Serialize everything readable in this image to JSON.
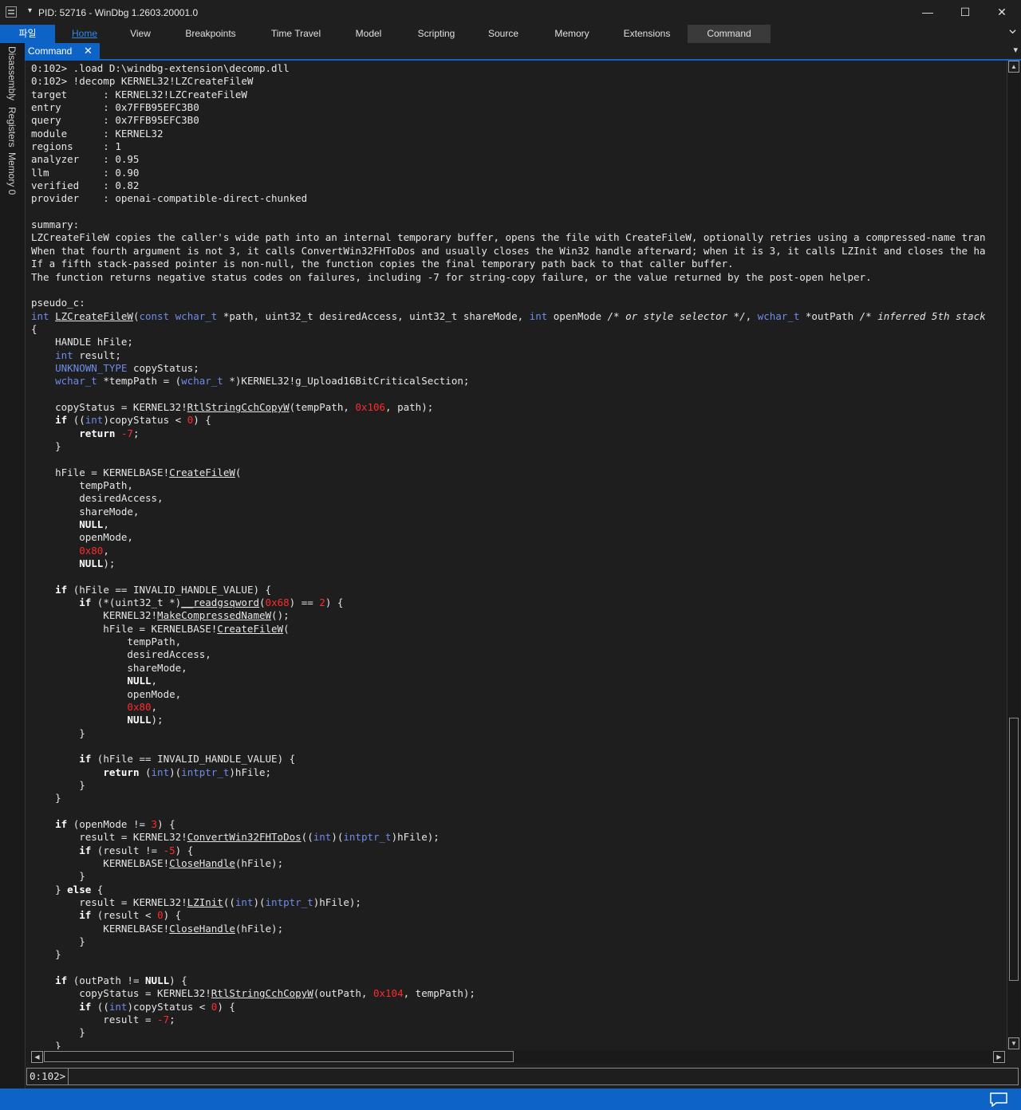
{
  "window": {
    "title": "PID: 52716 - WinDbg 1.2603.20001.0",
    "title_arrow": "▾",
    "buttons": {
      "minimize": "—",
      "maximize": "☐",
      "close": "✕"
    }
  },
  "ribbon": {
    "tabs": [
      {
        "label": "파일"
      },
      {
        "label": "Home"
      },
      {
        "label": "View"
      },
      {
        "label": "Breakpoints"
      },
      {
        "label": "Time Travel"
      },
      {
        "label": "Model"
      },
      {
        "label": "Scripting"
      },
      {
        "label": "Source"
      },
      {
        "label": "Memory"
      },
      {
        "label": "Extensions"
      },
      {
        "label": "Command"
      }
    ],
    "active_tab": "Home",
    "expand_icon": "chevron-down-icon"
  },
  "left_rail": {
    "items": [
      {
        "label": "Disassembly"
      },
      {
        "label": "Registers"
      },
      {
        "label": "Memory 0"
      }
    ]
  },
  "doc_tabs": {
    "tabs": [
      {
        "label": "Command",
        "close": "✕"
      }
    ],
    "menu_glyph": "▾"
  },
  "console": {
    "lines": [
      [
        {
          "t": "0:102> .load D:\\windbg-extension\\decomp.dll"
        }
      ],
      [
        {
          "t": "0:102> !decomp KERNEL32!LZCreateFileW"
        }
      ],
      [
        {
          "t": "target      : KERNEL32!LZCreateFileW"
        }
      ],
      [
        {
          "t": "entry       : 0x7FFB95EFC3B0"
        }
      ],
      [
        {
          "t": "query       : 0x7FFB95EFC3B0"
        }
      ],
      [
        {
          "t": "module      : KERNEL32"
        }
      ],
      [
        {
          "t": "regions     : 1"
        }
      ],
      [
        {
          "t": "analyzer    : 0.95"
        }
      ],
      [
        {
          "t": "llm         : 0.90"
        }
      ],
      [
        {
          "t": "verified    : 0.82"
        }
      ],
      [
        {
          "t": "provider    : openai-compatible-direct-chunked"
        }
      ],
      [
        {
          "t": ""
        }
      ],
      [
        {
          "t": "summary:"
        }
      ],
      [
        {
          "t": "LZCreateFileW copies the caller's wide path into an internal temporary buffer, opens the file with CreateFileW, optionally retries using a compressed-name tran"
        }
      ],
      [
        {
          "t": "When that fourth argument is not 3, it calls ConvertWin32FHToDos and usually closes the Win32 handle afterward; when it is 3, it calls LZInit and closes the ha"
        }
      ],
      [
        {
          "t": "If a fifth stack-passed pointer is non-null, the function copies the final temporary path back to that caller buffer."
        }
      ],
      [
        {
          "t": "The function returns negative status codes on failures, including -7 for string-copy failure, or the value returned by the post-open helper."
        }
      ],
      [
        {
          "t": ""
        }
      ],
      [
        {
          "t": "pseudo_c:"
        }
      ],
      [
        {
          "t": "int",
          "c": "kw"
        },
        {
          "t": " "
        },
        {
          "t": "LZCreateFileW",
          "c": "link"
        },
        {
          "t": "("
        },
        {
          "t": "const wchar_t",
          "c": "kw"
        },
        {
          "t": " *path, uint32_t desiredAccess, uint32_t shareMode, "
        },
        {
          "t": "int",
          "c": "kw"
        },
        {
          "t": " openMode "
        },
        {
          "t": "/* or style selector */",
          "c": "cm"
        },
        {
          "t": ", "
        },
        {
          "t": "wchar_t",
          "c": "kw"
        },
        {
          "t": " *outPath "
        },
        {
          "t": "/* inferred 5th stack",
          "c": "cm"
        }
      ],
      [
        {
          "t": "{"
        }
      ],
      [
        {
          "t": "    HANDLE hFile;"
        }
      ],
      [
        {
          "t": "    "
        },
        {
          "t": "int",
          "c": "kw"
        },
        {
          "t": " result;"
        }
      ],
      [
        {
          "t": "    "
        },
        {
          "t": "UNKNOWN_TYPE",
          "c": "kw"
        },
        {
          "t": " copyStatus;"
        }
      ],
      [
        {
          "t": "    "
        },
        {
          "t": "wchar_t",
          "c": "kw"
        },
        {
          "t": " *tempPath = ("
        },
        {
          "t": "wchar_t",
          "c": "kw"
        },
        {
          "t": " *)KERNEL32!g_Upload16BitCriticalSection;"
        }
      ],
      [
        {
          "t": ""
        }
      ],
      [
        {
          "t": "    copyStatus = KERNEL32!"
        },
        {
          "t": "RtlStringCchCopyW",
          "c": "link"
        },
        {
          "t": "(tempPath, "
        },
        {
          "t": "0x106",
          "c": "num"
        },
        {
          "t": ", path);"
        }
      ],
      [
        {
          "t": "    "
        },
        {
          "t": "if",
          "c": "kwb"
        },
        {
          "t": " (("
        },
        {
          "t": "int",
          "c": "kw"
        },
        {
          "t": ")copyStatus < "
        },
        {
          "t": "0",
          "c": "num"
        },
        {
          "t": ") {"
        }
      ],
      [
        {
          "t": "        "
        },
        {
          "t": "return",
          "c": "kwb"
        },
        {
          "t": " "
        },
        {
          "t": "-7",
          "c": "num"
        },
        {
          "t": ";"
        }
      ],
      [
        {
          "t": "    }"
        }
      ],
      [
        {
          "t": ""
        }
      ],
      [
        {
          "t": "    hFile = KERNELBASE!"
        },
        {
          "t": "CreateFileW",
          "c": "link"
        },
        {
          "t": "("
        }
      ],
      [
        {
          "t": "        tempPath,"
        }
      ],
      [
        {
          "t": "        desiredAccess,"
        }
      ],
      [
        {
          "t": "        shareMode,"
        }
      ],
      [
        {
          "t": "        "
        },
        {
          "t": "NULL",
          "c": "kwb"
        },
        {
          "t": ","
        }
      ],
      [
        {
          "t": "        openMode,"
        }
      ],
      [
        {
          "t": "        "
        },
        {
          "t": "0x80",
          "c": "num"
        },
        {
          "t": ","
        }
      ],
      [
        {
          "t": "        "
        },
        {
          "t": "NULL",
          "c": "kwb"
        },
        {
          "t": ");"
        }
      ],
      [
        {
          "t": ""
        }
      ],
      [
        {
          "t": "    "
        },
        {
          "t": "if",
          "c": "kwb"
        },
        {
          "t": " (hFile == INVALID_HANDLE_VALUE) {"
        }
      ],
      [
        {
          "t": "        "
        },
        {
          "t": "if",
          "c": "kwb"
        },
        {
          "t": " (*(uint32_t *)"
        },
        {
          "t": "__readgsqword",
          "c": "link"
        },
        {
          "t": "("
        },
        {
          "t": "0x68",
          "c": "num"
        },
        {
          "t": ") == "
        },
        {
          "t": "2",
          "c": "num"
        },
        {
          "t": ") {"
        }
      ],
      [
        {
          "t": "            KERNEL32!"
        },
        {
          "t": "MakeCompressedNameW",
          "c": "link"
        },
        {
          "t": "();"
        }
      ],
      [
        {
          "t": "            hFile = KERNELBASE!"
        },
        {
          "t": "CreateFileW",
          "c": "link"
        },
        {
          "t": "("
        }
      ],
      [
        {
          "t": "                tempPath,"
        }
      ],
      [
        {
          "t": "                desiredAccess,"
        }
      ],
      [
        {
          "t": "                shareMode,"
        }
      ],
      [
        {
          "t": "                "
        },
        {
          "t": "NULL",
          "c": "kwb"
        },
        {
          "t": ","
        }
      ],
      [
        {
          "t": "                openMode,"
        }
      ],
      [
        {
          "t": "                "
        },
        {
          "t": "0x80",
          "c": "num"
        },
        {
          "t": ","
        }
      ],
      [
        {
          "t": "                "
        },
        {
          "t": "NULL",
          "c": "kwb"
        },
        {
          "t": ");"
        }
      ],
      [
        {
          "t": "        }"
        }
      ],
      [
        {
          "t": ""
        }
      ],
      [
        {
          "t": "        "
        },
        {
          "t": "if",
          "c": "kwb"
        },
        {
          "t": " (hFile == INVALID_HANDLE_VALUE) {"
        }
      ],
      [
        {
          "t": "            "
        },
        {
          "t": "return",
          "c": "kwb"
        },
        {
          "t": " ("
        },
        {
          "t": "int",
          "c": "kw"
        },
        {
          "t": ")("
        },
        {
          "t": "intptr_t",
          "c": "kw"
        },
        {
          "t": ")hFile;"
        }
      ],
      [
        {
          "t": "        }"
        }
      ],
      [
        {
          "t": "    }"
        }
      ],
      [
        {
          "t": ""
        }
      ],
      [
        {
          "t": "    "
        },
        {
          "t": "if",
          "c": "kwb"
        },
        {
          "t": " (openMode != "
        },
        {
          "t": "3",
          "c": "num"
        },
        {
          "t": ") {"
        }
      ],
      [
        {
          "t": "        result = KERNEL32!"
        },
        {
          "t": "ConvertWin32FHToDos",
          "c": "link"
        },
        {
          "t": "(("
        },
        {
          "t": "int",
          "c": "kw"
        },
        {
          "t": ")("
        },
        {
          "t": "intptr_t",
          "c": "kw"
        },
        {
          "t": ")hFile);"
        }
      ],
      [
        {
          "t": "        "
        },
        {
          "t": "if",
          "c": "kwb"
        },
        {
          "t": " (result != "
        },
        {
          "t": "-5",
          "c": "num"
        },
        {
          "t": ") {"
        }
      ],
      [
        {
          "t": "            KERNELBASE!"
        },
        {
          "t": "CloseHandle",
          "c": "link"
        },
        {
          "t": "(hFile);"
        }
      ],
      [
        {
          "t": "        }"
        }
      ],
      [
        {
          "t": "    } "
        },
        {
          "t": "else",
          "c": "kwb"
        },
        {
          "t": " {"
        }
      ],
      [
        {
          "t": "        result = KERNEL32!"
        },
        {
          "t": "LZInit",
          "c": "link"
        },
        {
          "t": "(("
        },
        {
          "t": "int",
          "c": "kw"
        },
        {
          "t": ")("
        },
        {
          "t": "intptr_t",
          "c": "kw"
        },
        {
          "t": ")hFile);"
        }
      ],
      [
        {
          "t": "        "
        },
        {
          "t": "if",
          "c": "kwb"
        },
        {
          "t": " (result < "
        },
        {
          "t": "0",
          "c": "num"
        },
        {
          "t": ") {"
        }
      ],
      [
        {
          "t": "            KERNELBASE!"
        },
        {
          "t": "CloseHandle",
          "c": "link"
        },
        {
          "t": "(hFile);"
        }
      ],
      [
        {
          "t": "        }"
        }
      ],
      [
        {
          "t": "    }"
        }
      ],
      [
        {
          "t": ""
        }
      ],
      [
        {
          "t": "    "
        },
        {
          "t": "if",
          "c": "kwb"
        },
        {
          "t": " (outPath != "
        },
        {
          "t": "NULL",
          "c": "kwb"
        },
        {
          "t": ") {"
        }
      ],
      [
        {
          "t": "        copyStatus = KERNEL32!"
        },
        {
          "t": "RtlStringCchCopyW",
          "c": "link"
        },
        {
          "t": "(outPath, "
        },
        {
          "t": "0x104",
          "c": "num"
        },
        {
          "t": ", tempPath);"
        }
      ],
      [
        {
          "t": "        "
        },
        {
          "t": "if",
          "c": "kwb"
        },
        {
          "t": " (("
        },
        {
          "t": "int",
          "c": "kw"
        },
        {
          "t": ")copyStatus < "
        },
        {
          "t": "0",
          "c": "num"
        },
        {
          "t": ") {"
        }
      ],
      [
        {
          "t": "            result = "
        },
        {
          "t": "-7",
          "c": "num"
        },
        {
          "t": ";"
        }
      ],
      [
        {
          "t": "        }"
        }
      ],
      [
        {
          "t": "    }"
        }
      ]
    ]
  },
  "command_input": {
    "prompt": "0:102>",
    "value": ""
  },
  "statusbar": {
    "icon": "chat-icon"
  },
  "colors": {
    "accent": "#0e63c7",
    "keyword": "#6e8ce8",
    "number": "#ff2b2b",
    "background": "#1e1e1e"
  }
}
